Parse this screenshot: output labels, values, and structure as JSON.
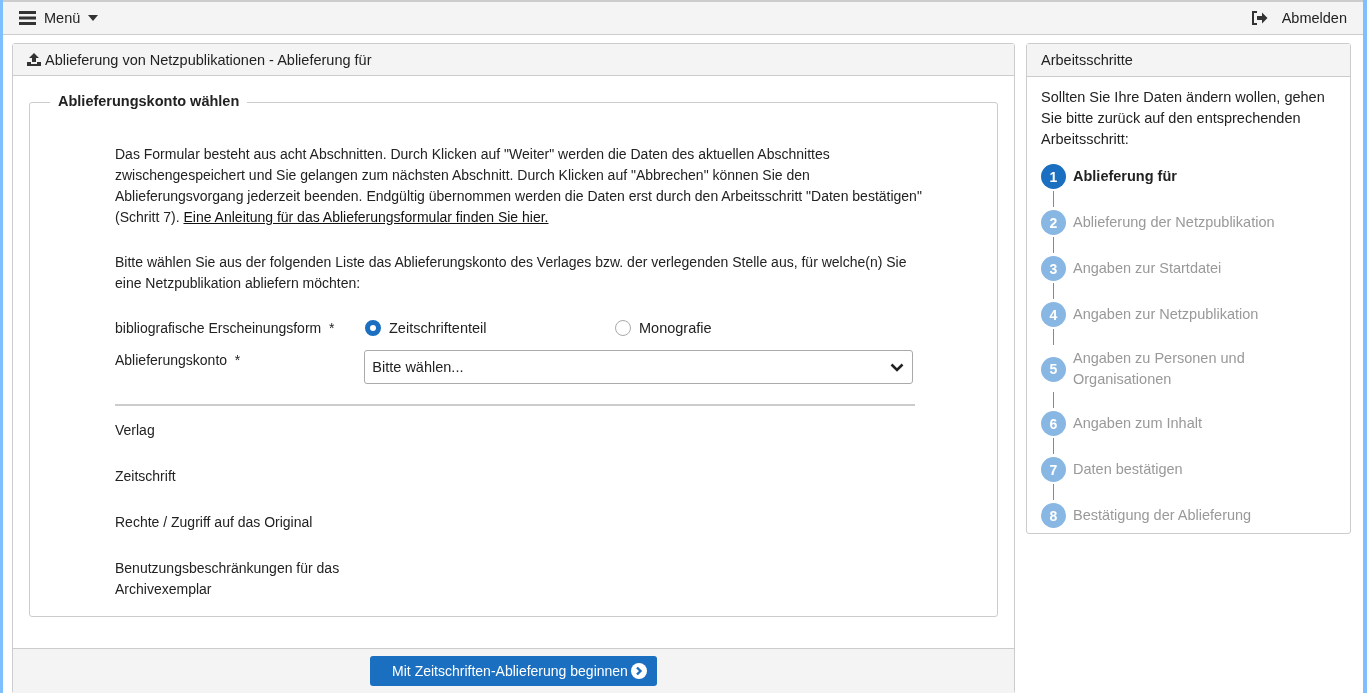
{
  "top_bar": {
    "menu_label": "Menü",
    "logout_label": "Abmelden"
  },
  "main_panel": {
    "title": "Ablieferung von Netzpublikationen - Ablieferung für",
    "fieldset": {
      "legend": "Ablieferungskonto wählen",
      "intro": {
        "text": "Das Formular besteht aus acht Abschnitten. Durch Klicken auf \"Weiter\" werden die Daten des aktuellen Abschnittes zwischengespeichert und Sie gelangen zum nächsten Abschnitt. Durch Klicken auf \"Abbrechen\" können Sie den Ablieferungsvorgang jederzeit beenden. Endgültig übernommen werden die Daten erst durch den Arbeitsschritt \"Daten bestätigen\" (Schritt 7).",
        "link": "Eine Anleitung für das Ablieferungsformular finden Sie hier."
      },
      "instruction": "Bitte wählen Sie aus der folgenden Liste das Ablieferungskonto des Verlages bzw. der verlegenden Stelle aus, für welche(n) Sie eine Netzpublikation abliefern möchten:",
      "form_type": {
        "label": "bibliografische Erscheinungsform",
        "required": "*",
        "options": [
          {
            "label": "Zeitschriftenteil",
            "selected": true
          },
          {
            "label": "Monografie",
            "selected": false
          }
        ]
      },
      "account": {
        "label": "Ablieferungskonto",
        "required": "*",
        "value": "Bitte wählen..."
      },
      "info_rows": [
        "Verlag",
        "Zeitschrift",
        "Rechte / Zugriff auf das Original",
        "Benutzungsbeschränkungen für das Archivexemplar"
      ]
    },
    "submit_button": "Mit Zeitschriften-Ablieferung beginnen"
  },
  "steps_panel": {
    "title": "Arbeitsschritte",
    "hint": "Sollten Sie Ihre Daten ändern wollen, gehen Sie bitte zurück auf den entsprechenden Arbeitsschritt:",
    "steps": [
      {
        "number": "1",
        "label": "Ablieferung für",
        "selected": true
      },
      {
        "number": "2",
        "label": "Ablieferung der Netzpublikation",
        "selected": false
      },
      {
        "number": "3",
        "label": "Angaben zur Startdatei",
        "selected": false
      },
      {
        "number": "4",
        "label": "Angaben zur Netzpublikation",
        "selected": false
      },
      {
        "number": "5",
        "label": "Angaben zu Personen und Organisationen",
        "selected": false
      },
      {
        "number": "6",
        "label": "Angaben zum Inhalt",
        "selected": false
      },
      {
        "number": "7",
        "label": "Daten bestätigen",
        "selected": false
      },
      {
        "number": "8",
        "label": "Bestätigung der Ablieferung",
        "selected": false
      }
    ]
  }
}
